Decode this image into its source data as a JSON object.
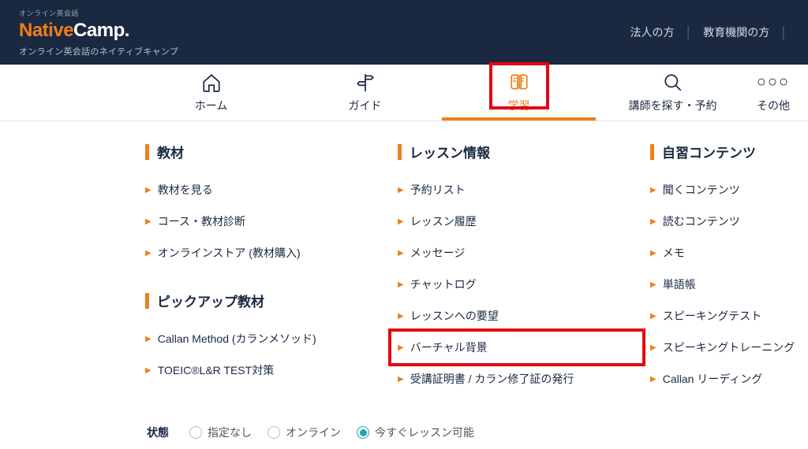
{
  "header": {
    "logo_tag": "オンライン英会話",
    "logo_native": "Native",
    "logo_camp": "Camp.",
    "logo_sub": "オンライン英会話のネイティブキャンプ",
    "links": [
      "法人の方",
      "教育機関の方"
    ]
  },
  "nav": {
    "items": [
      {
        "label": "ホーム"
      },
      {
        "label": "ガイド"
      },
      {
        "label": "学習"
      },
      {
        "label": "講師を探す・予約"
      },
      {
        "label": "その他"
      }
    ]
  },
  "dropdown": {
    "col1": {
      "section1": {
        "title": "教材",
        "items": [
          "教材を見る",
          "コース・教材診断",
          "オンラインストア (教材購入)"
        ]
      },
      "section2": {
        "title": "ピックアップ教材",
        "items": [
          "Callan Method (カランメソッド)",
          "TOEIC®L&R TEST対策"
        ]
      }
    },
    "col2": {
      "section1": {
        "title": "レッスン情報",
        "items": [
          "予約リスト",
          "レッスン履歴",
          "メッセージ",
          "チャットログ",
          "レッスンへの要望",
          "バーチャル背景",
          "受講証明書 / カラン修了証の発行"
        ]
      }
    },
    "col3": {
      "section1": {
        "title": "自習コンテンツ",
        "items": [
          "聞くコンテンツ",
          "読むコンテンツ",
          "メモ",
          "単語帳",
          "スピーキングテスト",
          "スピーキングトレーニング",
          "Callan リーディング"
        ]
      }
    }
  },
  "status": {
    "label": "状態",
    "options": [
      "指定なし",
      "オンライン",
      "今すぐレッスン可能"
    ],
    "selected_index": 2
  }
}
